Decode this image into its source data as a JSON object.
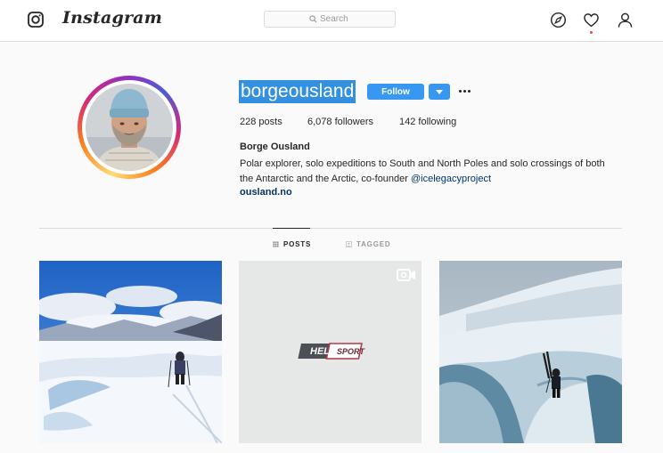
{
  "topbar": {
    "logo_icon": "instagram-camera-icon",
    "wordmark": "Instagram",
    "search_placeholder": "Search",
    "icons": [
      "compass-icon",
      "heart-icon",
      "profile-icon"
    ]
  },
  "profile": {
    "username": "borgeousland",
    "follow_label": "Follow",
    "dropdown_icon": "chevron-down-icon",
    "more_icon": "more-options-icon",
    "stats": {
      "posts": "228 posts",
      "followers": "6,078 followers",
      "following": "142 following"
    },
    "full_name": "Borge Ousland",
    "bio_line1": "Polar explorer, solo expeditions to South and North Poles and solo crossings of both",
    "bio_line2_prefix": "the Antarctic and the Arctic, co-founder ",
    "bio_mention": "@icelegacyproject",
    "website": "ousland.no"
  },
  "tabs": [
    {
      "label": "POSTS",
      "active": true,
      "icon": "grid-icon"
    },
    {
      "label": "TAGGED",
      "active": false,
      "icon": "tagged-icon"
    }
  ],
  "posts": [
    {
      "kind": "photo"
    },
    {
      "kind": "video",
      "brand": "HEL",
      "brand2": "SPORT",
      "icon": "video-camera-icon"
    },
    {
      "kind": "photo"
    }
  ],
  "colors": {
    "accent": "#3897f0",
    "selection": "#3390e0",
    "link": "#003569",
    "border": "#dbdbdb",
    "background": "#fafafa"
  }
}
